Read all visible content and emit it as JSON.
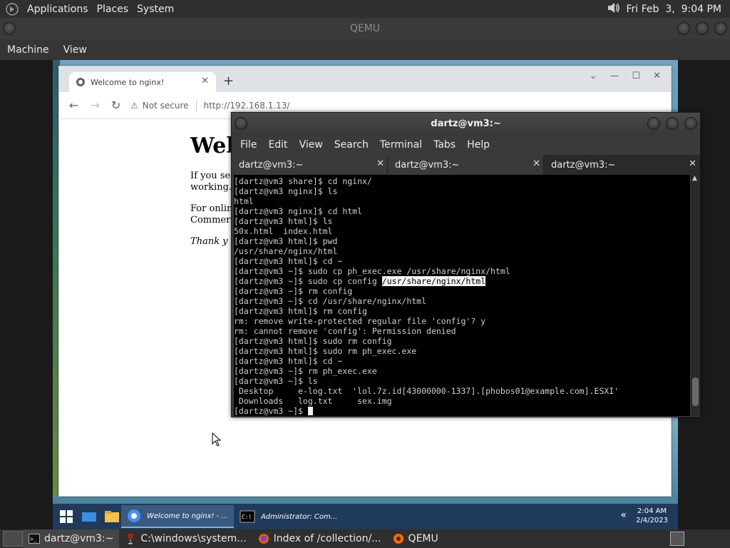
{
  "top_panel": {
    "menus": [
      "Applications",
      "Places",
      "System"
    ],
    "clock": "Fri Feb  3,  9:04 PM"
  },
  "qemu": {
    "title": "QEMU",
    "menus": [
      "Machine",
      "View"
    ]
  },
  "browser": {
    "tab_title": "Welcome to nginx!",
    "security": "Not secure",
    "url": "http://192.168.1.13/",
    "heading": "Wel",
    "para1": "If you se",
    "para1b": "working.",
    "para2": "For onlin",
    "para2b": "Commer",
    "para3": "Thank y"
  },
  "guest_taskbar": {
    "tasks": [
      "Welcome to nginx! - ...",
      "Administrator: Com..."
    ],
    "time": "2:04 AM",
    "date": "2/4/2023"
  },
  "terminal": {
    "title": "dartz@vm3:~",
    "menus": [
      "File",
      "Edit",
      "View",
      "Search",
      "Terminal",
      "Tabs",
      "Help"
    ],
    "tabs": [
      "dartz@vm3:~",
      "dartz@vm3:~",
      "dartz@vm3:~"
    ],
    "lines": [
      "[dartz@vm3 share]$ cd nginx/",
      "[dartz@vm3 nginx]$ ls",
      "html",
      "[dartz@vm3 nginx]$ cd html",
      "[dartz@vm3 html]$ ls",
      "50x.html  index.html",
      "[dartz@vm3 html]$ pwd",
      "/usr/share/nginx/html",
      "[dartz@vm3 html]$ cd ~",
      "[dartz@vm3 ~]$ sudo cp ph_exec.exe /usr/share/nginx/html",
      "[dartz@vm3 ~]$ sudo cp config ",
      "[dartz@vm3 ~]$ rm config",
      "[dartz@vm3 ~]$ cd /usr/share/nginx/html",
      "[dartz@vm3 html]$ rm config",
      "rm: remove write-protected regular file 'config'? y",
      "rm: cannot remove 'config': Permission denied",
      "[dartz@vm3 html]$ sudo rm config",
      "[dartz@vm3 html]$ sudo rm ph_exec.exe",
      "[dartz@vm3 html]$ cd ~",
      "[dartz@vm3 ~]$ rm ph_exec.exe",
      "[dartz@vm3 ~]$ ls",
      " Desktop     e-log.txt  'lol.7z.id[43000000-1337].[phobos01@example.com].ESXI'",
      " Downloads   log.txt     sex.img",
      "[dartz@vm3 ~]$ "
    ],
    "highlight": "/usr/share/nginx/html"
  },
  "bottom_panel": {
    "tasks": [
      "dartz@vm3:~",
      "C:\\windows\\system...",
      "Index of /collection/...",
      "QEMU"
    ]
  }
}
